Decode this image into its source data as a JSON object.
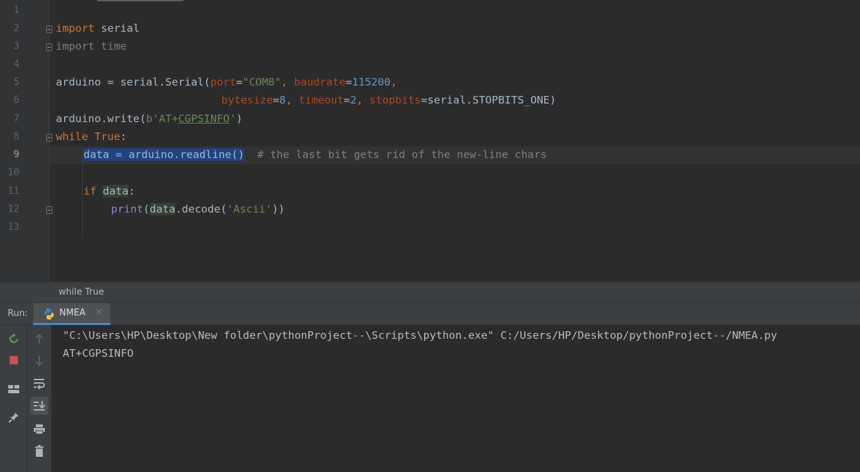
{
  "editor": {
    "line_numbers": [
      "1",
      "2",
      "3",
      "4",
      "5",
      "6",
      "7",
      "8",
      "9",
      "10",
      "11",
      "12",
      "13"
    ],
    "current_line": "9",
    "code": {
      "l2": {
        "kw": "import",
        "rest": " serial"
      },
      "l3": {
        "kw": "import",
        "rest": " time"
      },
      "l5": {
        "a": "arduino = serial.Serial(",
        "p1": "port",
        "eq1": "=",
        "s1": "\"COM8\"",
        "c1": ", ",
        "p2": "baudrate",
        "eq2": "=",
        "n1": "115200",
        "c2": ","
      },
      "l6": {
        "p3": "bytesize",
        "eq3": "=",
        "n2": "8",
        "c3": ", ",
        "p4": "timeout",
        "eq4": "=",
        "n3": "2",
        "c4": ", ",
        "p5": "stopbits",
        "eq5": "=serial.STOPBITS_ONE)"
      },
      "l7": {
        "a": "arduino.write(",
        "s_open": "b'AT+",
        "s_under": "CGPSINFO",
        "s_close": "'",
        "b": ")"
      },
      "l8": {
        "kw": "while",
        "sp": " ",
        "kw2": "True",
        "b": ":"
      },
      "l9": {
        "sel": "data = arduino.readline()",
        "cmt": "  # the last bit gets rid of the new-line chars"
      },
      "l11": {
        "kw": "if",
        "sp": " ",
        "var": "data",
        "b": ":"
      },
      "l12": {
        "fn": "print",
        "a": "(",
        "var": "data",
        "b": ".decode(",
        "s": "'Ascii'",
        "c": "))"
      }
    }
  },
  "breadcrumb": {
    "text": "while True"
  },
  "run": {
    "label": "Run:",
    "tab_label": "NMEA",
    "tab_close": "×",
    "console_lines": [
      "\"C:\\Users\\HP\\Desktop\\New folder\\pythonProject--\\Scripts\\python.exe\" C:/Users/HP/Desktop/pythonProject--/NMEA.py",
      "AT+CGPSINFO"
    ]
  },
  "colors": {
    "background": "#2b2b2b",
    "keyword": "#cc7832",
    "string": "#6a8759",
    "number": "#6897bb",
    "param": "#aa4926",
    "selection": "#214283",
    "rerun_green": "#499c54",
    "stop_red": "#c75450"
  },
  "icons": {
    "rerun": "rerun-icon",
    "stop": "stop-icon",
    "layout": "layout-icon",
    "pin": "pin-icon",
    "up": "arrow-up-icon",
    "down": "arrow-down-icon",
    "soft_wrap": "soft-wrap-icon",
    "scroll_end": "scroll-to-end-icon",
    "print": "print-icon",
    "trash": "trash-icon"
  }
}
